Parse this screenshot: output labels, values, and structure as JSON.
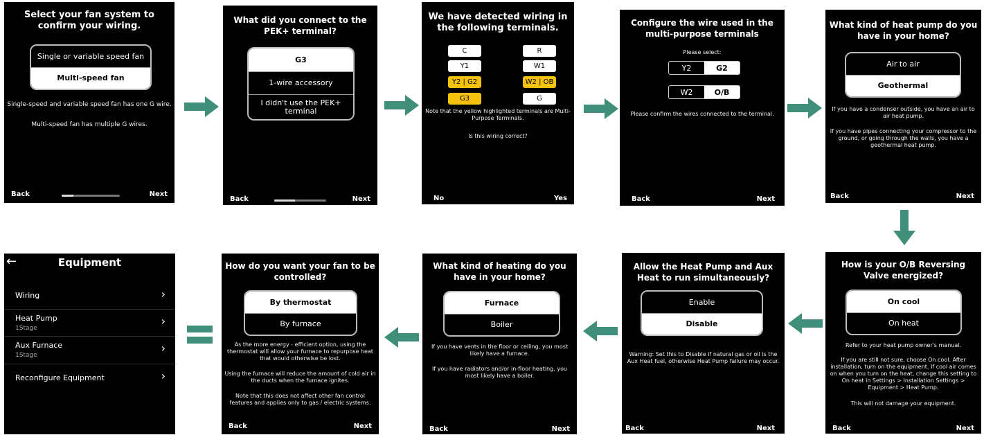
{
  "colors": {
    "accent_green": "#3f8f7a",
    "terminal_yellow": "#f4c20d"
  },
  "s1": {
    "title": "Select your fan system to confirm your wiring.",
    "options": [
      "Single or variable speed fan",
      "Multi-speed fan"
    ],
    "info1": "Single-speed and variable speed fan has one G wire.",
    "info2": "Multi-speed fan has multiple G wires.",
    "back": "Back",
    "next": "Next",
    "progress": 0.2
  },
  "s2": {
    "title": "What did you connect to the PEK+ terminal?",
    "options": [
      "G3",
      "1-wire accessory",
      "I didn't use the PEK+ terminal"
    ],
    "back": "Back",
    "next": "Next",
    "progress": 0.4
  },
  "s3": {
    "title": "We have detected wiring in the following terminals.",
    "terminals_left": [
      "C",
      "Y1",
      "Y2 | G2",
      "G3"
    ],
    "terminals_right": [
      "R",
      "W1",
      "W2 | OB",
      "G"
    ],
    "note": "Note that the yellow highlighted terminals are Multi-Purpose Terminals.",
    "question": "Is this wiring correct?",
    "no": "No",
    "yes": "Yes"
  },
  "s4": {
    "title": "Configure the wire used in the multi-purpose terminals",
    "prompt": "Please select:",
    "seg1": [
      "Y2",
      "G2"
    ],
    "seg2": [
      "W2",
      "O/B"
    ],
    "info": "Please confirm the wires connected to the terminal.",
    "back": "Back",
    "next": "Next"
  },
  "s5": {
    "title": "What kind of heat pump do you have in your home?",
    "options": [
      "Air to air",
      "Geothermal"
    ],
    "info1": "If you have a condenser outside, you have an air to air heat pump.",
    "info2": "If you have pipes connecting your compressor to the ground, or going through the walls, you have a geothermal heat pump.",
    "back": "Back",
    "next": "Next"
  },
  "s6": {
    "title": "How is your O/B Reversing Valve energized?",
    "options": [
      "On cool",
      "On heat"
    ],
    "info1": "Refer to your heat pump owner's manual.",
    "info2": "If you are still not sure, choose On cool.  After installation, turn on the equipment.  If cool air comes on when you turn on the heat, change this setting to On heat in Settings > Installation Settings > Equipment > Heat Pump.",
    "info3": "This will not damage your equipment.",
    "back": "Back",
    "next": "Next"
  },
  "s7": {
    "title": "Allow the Heat Pump and Aux Heat to run simultaneously?",
    "options": [
      "Enable",
      "Disable"
    ],
    "info": "Warning:  Set this to Disable if natural gas or oil is the Aux Heat fuel, otherwise Heat Pump failure may occur.",
    "back": "Back",
    "next": "Next"
  },
  "s8": {
    "title": "What kind of heating do you have in your home?",
    "options": [
      "Furnace",
      "Boiler"
    ],
    "info1": "If you have vents in the floor or ceiling, you most likely have a furnace.",
    "info2": "If you have radiators and/or in-floor heating, you most likely have a boiler.",
    "back": "Back",
    "next": "Next"
  },
  "s9": {
    "title": "How do you want your fan to be controlled?",
    "options": [
      "By thermostat",
      "By furnace"
    ],
    "info1": "As the more energy - efficient option, using the thermostat will allow your furnace to repurpose heat that would otherwise be lost.",
    "info2": "Using the furnace will reduce the amount of cold air in the ducts when the furnace ignites.",
    "info3": "Note that this does not affect other fan control features and applies only to gas / electric systems.",
    "back": "Back",
    "next": "Next"
  },
  "s10": {
    "title": "Equipment",
    "back_icon": "←",
    "items": [
      {
        "label": "Wiring",
        "sub": ""
      },
      {
        "label": "Heat Pump",
        "sub": "1Stage"
      },
      {
        "label": "Aux Furnace",
        "sub": "1Stage"
      },
      {
        "label": "Reconfigure Equipment",
        "sub": ""
      }
    ]
  },
  "icons": {
    "arrow": "arrow-icon",
    "chevron": "›",
    "equals": "equals-icon"
  }
}
